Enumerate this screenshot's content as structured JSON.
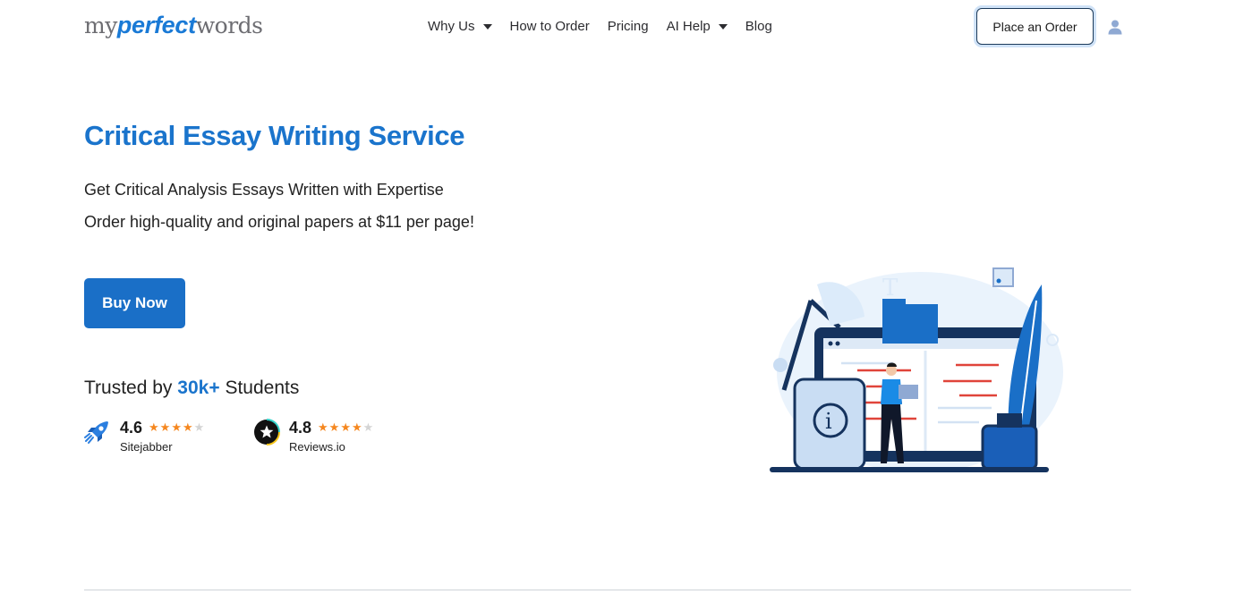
{
  "brand": {
    "logo_my": "my",
    "logo_perfect": "perfect",
    "logo_words": "words",
    "accent_color": "#1a74cc"
  },
  "nav": {
    "items": [
      {
        "label": "Why Us",
        "has_dropdown": true
      },
      {
        "label": "How to Order",
        "has_dropdown": false
      },
      {
        "label": "Pricing",
        "has_dropdown": false
      },
      {
        "label": "AI Help",
        "has_dropdown": true
      },
      {
        "label": "Blog",
        "has_dropdown": false
      }
    ],
    "order_button": "Place an Order",
    "user_icon": "user-icon"
  },
  "hero": {
    "title": "Critical Essay Writing Service",
    "subtitle_1": "Get Critical Analysis Essays Written with Expertise",
    "subtitle_2": "Order high-quality and original papers at $11 per page!",
    "cta": "Buy Now",
    "trusted_prefix": "Trusted by",
    "trusted_count": "30k+",
    "trusted_suffix": "Students"
  },
  "ratings": [
    {
      "score": "4.6",
      "source": "Sitejabber",
      "stars_filled": 4,
      "stars_total": 5,
      "icon": "rocket-icon"
    },
    {
      "score": "4.8",
      "source": "Reviews.io",
      "stars_filled": 4,
      "stars_total": 5,
      "icon": "star-badge-icon"
    }
  ]
}
